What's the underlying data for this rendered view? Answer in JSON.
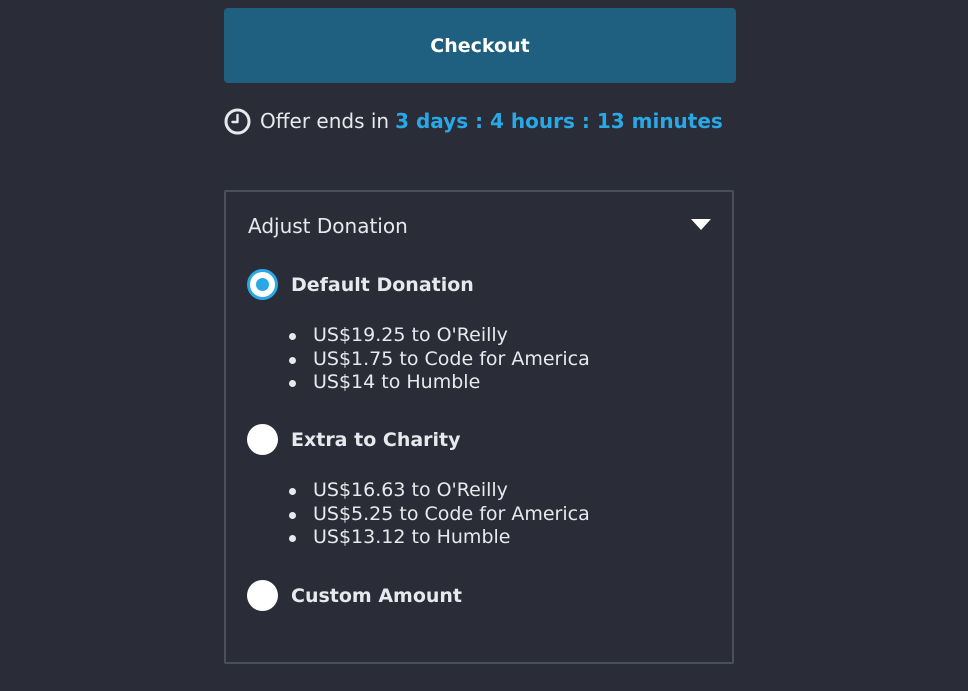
{
  "checkout": {
    "label": "Checkout"
  },
  "offer": {
    "prefix": "Offer ends in",
    "time": "3 days : 4 hours : 13 minutes",
    "icon": "clock-icon"
  },
  "donation": {
    "title": "Adjust Donation",
    "toggle_icon": "chevron-down-icon",
    "options": [
      {
        "label": "Default Donation",
        "selected": true,
        "breakdown": [
          "US$19.25 to O'Reilly",
          "US$1.75 to Code for America",
          "US$14 to Humble"
        ]
      },
      {
        "label": "Extra to Charity",
        "selected": false,
        "breakdown": [
          "US$16.63 to O'Reilly",
          "US$5.25 to Code for America",
          "US$13.12 to Humble"
        ]
      },
      {
        "label": "Custom Amount",
        "selected": false,
        "breakdown": []
      }
    ]
  },
  "colors": {
    "background": "#2a2c37",
    "button": "#1f5f7f",
    "accent": "#2aa8e6",
    "text": "#e8e9ee",
    "panel_border": "#4b4e5b"
  }
}
